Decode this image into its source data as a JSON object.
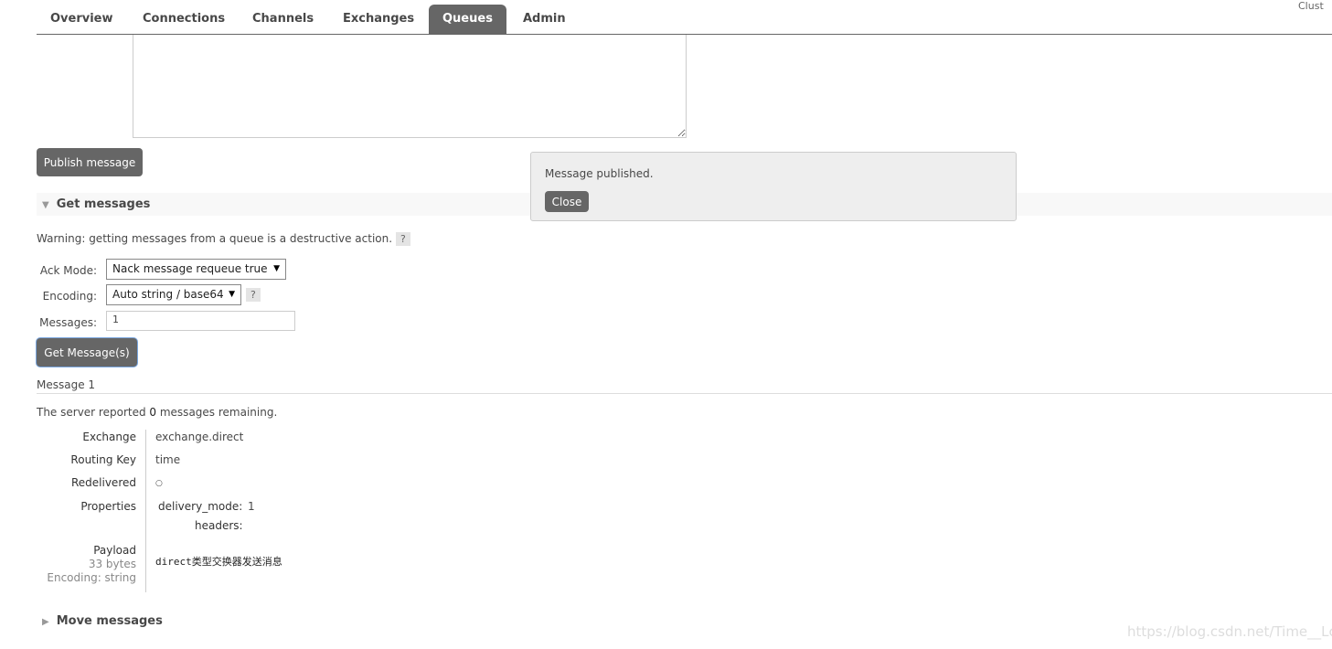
{
  "header": {
    "cluster": "Clust"
  },
  "tabs": [
    {
      "label": "Overview"
    },
    {
      "label": "Connections"
    },
    {
      "label": "Channels"
    },
    {
      "label": "Exchanges"
    },
    {
      "label": "Queues",
      "active": true
    },
    {
      "label": "Admin"
    }
  ],
  "publish": {
    "button": "Publish message",
    "payload": ""
  },
  "popup": {
    "text": "Message published.",
    "close": "Close"
  },
  "get": {
    "title": "Get messages",
    "warning": "Warning: getting messages from a queue is a destructive action.",
    "help": "?",
    "ack_label": "Ack Mode:",
    "ack_value": "Nack message requeue true",
    "enc_label": "Encoding:",
    "enc_value": "Auto string / base64",
    "msgs_label": "Messages:",
    "msgs_value": "1",
    "button": "Get Message(s)"
  },
  "message": {
    "title": "Message 1",
    "reported_pre": "The server reported ",
    "reported_count": "0",
    "reported_post": " messages remaining.",
    "exchange_k": "Exchange",
    "exchange_v": "exchange.direct",
    "routing_k": "Routing Key",
    "routing_v": "time",
    "redelivered_k": "Redelivered",
    "redelivered_v": "○",
    "properties_k": "Properties",
    "dm_k": "delivery_mode:",
    "dm_v": "1",
    "headers_k": "headers:",
    "payload_k": "Payload",
    "payload_size": "33 bytes",
    "payload_enc": "Encoding: string",
    "payload_v": "direct类型交换器发送消息"
  },
  "move": {
    "title": "Move messages"
  },
  "watermark": "https://blog.csdn.net/Time__Lc",
  "colors": {
    "tab_active": "#666666",
    "button": "#666666"
  }
}
